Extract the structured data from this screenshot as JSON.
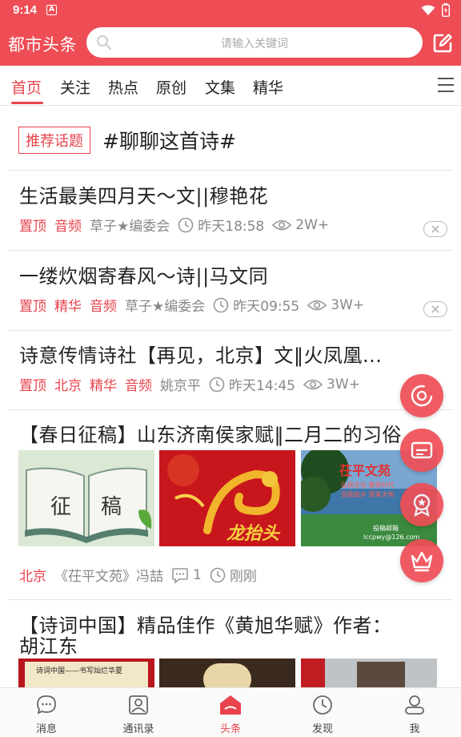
{
  "status_bar": {
    "time": "9:14",
    "a_badge": "A"
  },
  "header": {
    "title": "都市头条",
    "search_placeholder": "请输入关键词"
  },
  "tabs": [
    {
      "label": "首页",
      "active": true
    },
    {
      "label": "关注"
    },
    {
      "label": "热点"
    },
    {
      "label": "原创"
    },
    {
      "label": "文集"
    },
    {
      "label": "精华"
    }
  ],
  "topic": {
    "tag": "推荐话题",
    "text": "#聊聊这首诗#"
  },
  "articles": [
    {
      "title": "生活最美四月天～文||穆艳花",
      "tags": [
        "置顶",
        "音频"
      ],
      "author": "草子★编委会",
      "time": "昨天18:58",
      "views": "2W+"
    },
    {
      "title": "一缕炊烟寄春风～诗||马文同",
      "tags": [
        "置顶",
        "精华",
        "音频"
      ],
      "author": "草子★编委会",
      "time": "昨天09:55",
      "views": "3W+"
    },
    {
      "title": "诗意传情诗社【再见，北京】文‖火凤凰...",
      "tags": [
        "置顶",
        "北京",
        "精华",
        "音频"
      ],
      "author": "姚京平",
      "time": "昨天14:45",
      "views": "3W+"
    },
    {
      "title": "【春日征稿】山东济南侯家赋‖二月二的习俗",
      "tags": [
        "北京"
      ],
      "author": "《茌平文苑》冯喆",
      "comments": "1",
      "time": "刚刚",
      "thumb1": {
        "char1": "征",
        "char2": "稿"
      },
      "thumb2": {
        "text": "龙抬头"
      },
      "thumb3": {
        "title": "茌平文苑",
        "line1": "弘扬文化 繁荣时代",
        "line2": "讴歌故乡 赞美大地",
        "line3": "投稿邮箱",
        "line4": "lccpwy@126.com"
      }
    },
    {
      "title_line1": "【诗词中国】精品佳作《黄旭华赋》作者：",
      "title_line2": "胡江东",
      "thumb1": {
        "text": "诗词中国——书写灿烂华夏"
      }
    }
  ],
  "bottom_nav": [
    {
      "label": "消息",
      "icon": "message-icon"
    },
    {
      "label": "通讯录",
      "icon": "contacts-icon"
    },
    {
      "label": "头条",
      "icon": "home-icon",
      "active": true
    },
    {
      "label": "发现",
      "icon": "compass-icon"
    },
    {
      "label": "我",
      "icon": "user-icon"
    }
  ],
  "colors": {
    "brand": "#ee4d55",
    "accent": "#e8434c",
    "text": "#222222",
    "muted": "#888888"
  }
}
